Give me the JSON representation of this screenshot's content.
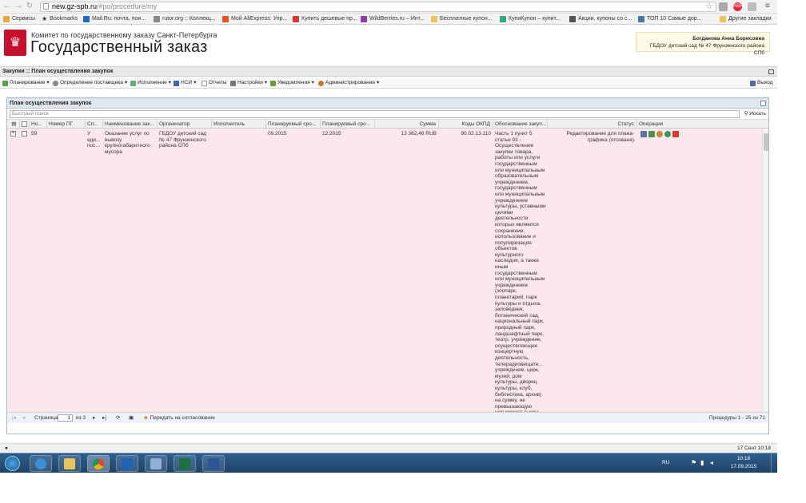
{
  "browser": {
    "url_domain": "new.gz-spb.ru",
    "url_path": "/#po/procedure/my",
    "bookmarks": [
      "Сервисы",
      "Bookmarks",
      "Mail.Ru: почта, пои...",
      "rutor.org :: Коллекц...",
      "Мой AliExpress: Упр...",
      "Купить дешевые пр...",
      "WildBerries.ru – Инт...",
      "Бесплатные купон...",
      "КупиКупон – купит...",
      "Акции, купоны со с...",
      "ТОП 10 Самые дор...",
      "Другие закладки"
    ],
    "colors": {
      "accent": "#c8102e"
    }
  },
  "header": {
    "committee": "Комитет по государственному заказу Санкт-Петербурга",
    "title": "Государственный заказ",
    "user_name": "Богданова Анна Борисовна",
    "user_org": "ГБДОУ детский сад № 47 Фрунзенского района СПб"
  },
  "breadcrumb": "Закупки :: План осуществления закупок",
  "menu": {
    "items": [
      "Планирование",
      "Определение поставщика",
      "Исполнение",
      "НСИ",
      "Отчеты",
      "Настройки",
      "Уведомления",
      "Администрирование"
    ],
    "exit": "Выход"
  },
  "panel": {
    "title": "План осуществления закупок",
    "search_placeholder": "Быстрый поиск",
    "search_button": "Искать",
    "columns": [
      "Но...",
      "Номер ПГ",
      "Сп...",
      "Наименование зак...",
      "Организатор",
      "Исполнитель",
      "Планируемый сро...",
      "Планируемый сро...",
      "Сумма",
      "Коды ОКПД",
      "Обоснование закуп...",
      "Статус",
      "Операции"
    ],
    "row": {
      "no": "59",
      "pg_number": "",
      "method": "У еди... пос...",
      "name": "Оказание услуг по вывозу крупногабаритного мусора",
      "organizer": "ГБДОУ детский сад № 47 Фрунзенского района СПб",
      "executor": "",
      "date1": "09.2015",
      "date2": "12.2015",
      "sum": "13 362,46 RUB",
      "okpd": "90.02.13.110",
      "basis": "Часть 1 пункт 5 статьи 93 - Осуществление закупки товара, работы или услуги государственным или муниципальным образовательным учреждением, государственным или муниципальным учреждением культуры, уставными целями деятельности которых являются сохранение, использование и популяризация объектов культурного наследия, а также иным государственным или муниципальным учреждением (зоопарк, планетарий, парк культуры и отдыха, заповедник, ботанический сад, национальный парк, природный парк, ландшафтный парк, театр, учреждение, осуществляющее концертную деятельность, телерадиовещате... учреждение, цирк, музей, дом культуры, дворец культуры, клуб, библиотека, архив) на сумму, не превышающую четырехсот тысяч рублей",
      "status": "Редактирование для плана-графика (отозвана)"
    },
    "pager": {
      "page_label": "Страница",
      "page_value": "1",
      "of_label": "из 3",
      "send_label": "Передать на согласование",
      "summary": "Процедуры 1 - 25 из 71"
    }
  },
  "statusbar": {
    "datetime": "17 Сент 10:18"
  },
  "taskbar": {
    "lang": "RU",
    "time": "10:18",
    "date": "17.09.2015"
  }
}
